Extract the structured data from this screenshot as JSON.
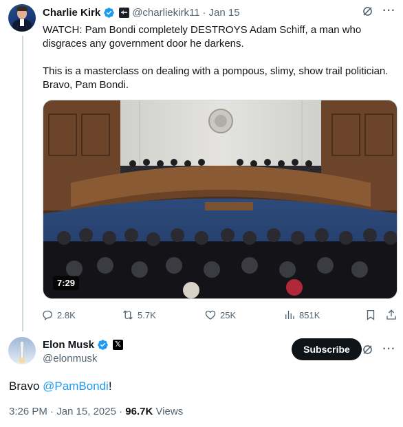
{
  "tweet": {
    "author_name": "Charlie Kirk",
    "handle": "@charliekirk11",
    "separator": "·",
    "date": "Jan 15",
    "text_line1": "WATCH: Pam Bondi completely DESTROYS Adam Schiff, a man who disgraces any government door he darkens.",
    "text_line2": "This is a masterclass on dealing with a pompous, slimy, show trail politician. Bravo, Pam Bondi.",
    "video_duration": "7:29",
    "replies": "2.8K",
    "reposts": "5.7K",
    "likes": "25K",
    "views": "851K"
  },
  "reply": {
    "author_name": "Elon Musk",
    "handle": "@elonmusk",
    "subscribe_label": "Subscribe",
    "text_before": "Bravo ",
    "mention": "@PamBondi",
    "text_after": "!",
    "time_date": "3:26 PM · Jan 15, 2025 · ",
    "view_count": "96.7K",
    "views_label": " Views"
  },
  "colors": {
    "accent": "#1d9bf0",
    "muted_text": "#536471",
    "primary_text": "#0f1419",
    "thread_line": "#cfd9de"
  },
  "icons": [
    "verified-badge-icon",
    "government-badge-icon",
    "grok-icon",
    "more-icon",
    "reply-icon",
    "repost-icon",
    "like-icon",
    "views-icon",
    "bookmark-icon",
    "share-icon",
    "x-badge-icon"
  ]
}
